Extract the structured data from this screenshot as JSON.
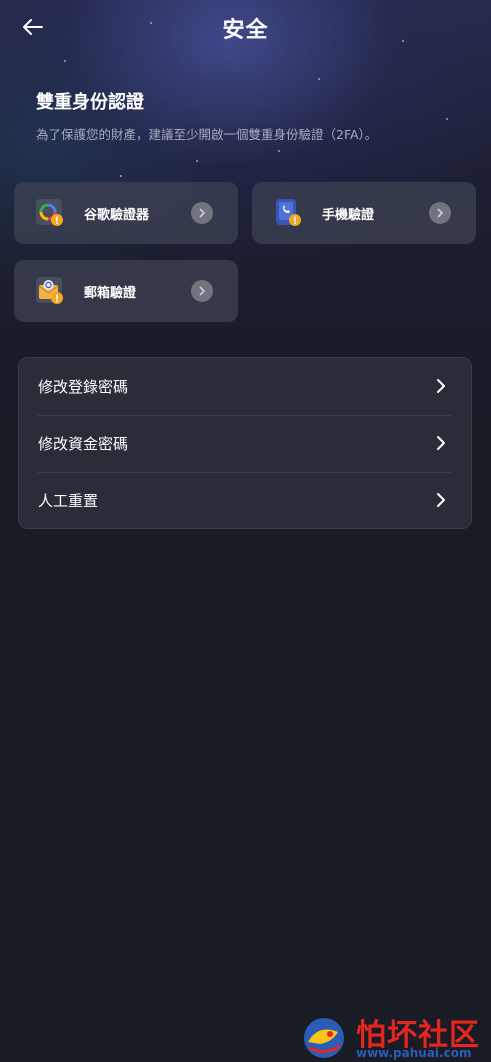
{
  "header": {
    "title": "安全"
  },
  "two_factor": {
    "title": "雙重身份認證",
    "description": "為了保護您的財產，建議至少開啟一個雙重身份驗證（2FA）。",
    "methods": [
      {
        "label": "谷歌驗證器",
        "icon": "google-authenticator-icon"
      },
      {
        "label": "手機驗證",
        "icon": "phone-icon"
      },
      {
        "label": "郵箱驗證",
        "icon": "email-icon"
      }
    ]
  },
  "menu": {
    "items": [
      {
        "label": "修改登錄密碼"
      },
      {
        "label": "修改資金密碼"
      },
      {
        "label": "人工重置"
      }
    ]
  },
  "watermark": {
    "title": "怕坏社区",
    "url": "www.pahuai.com"
  },
  "colors": {
    "background": "#191b25",
    "card": "#3e4254",
    "panel": "#2a2c37",
    "warning_badge": "#f5a623",
    "watermark_red": "#e4261f",
    "watermark_blue": "#2c5cb5"
  }
}
